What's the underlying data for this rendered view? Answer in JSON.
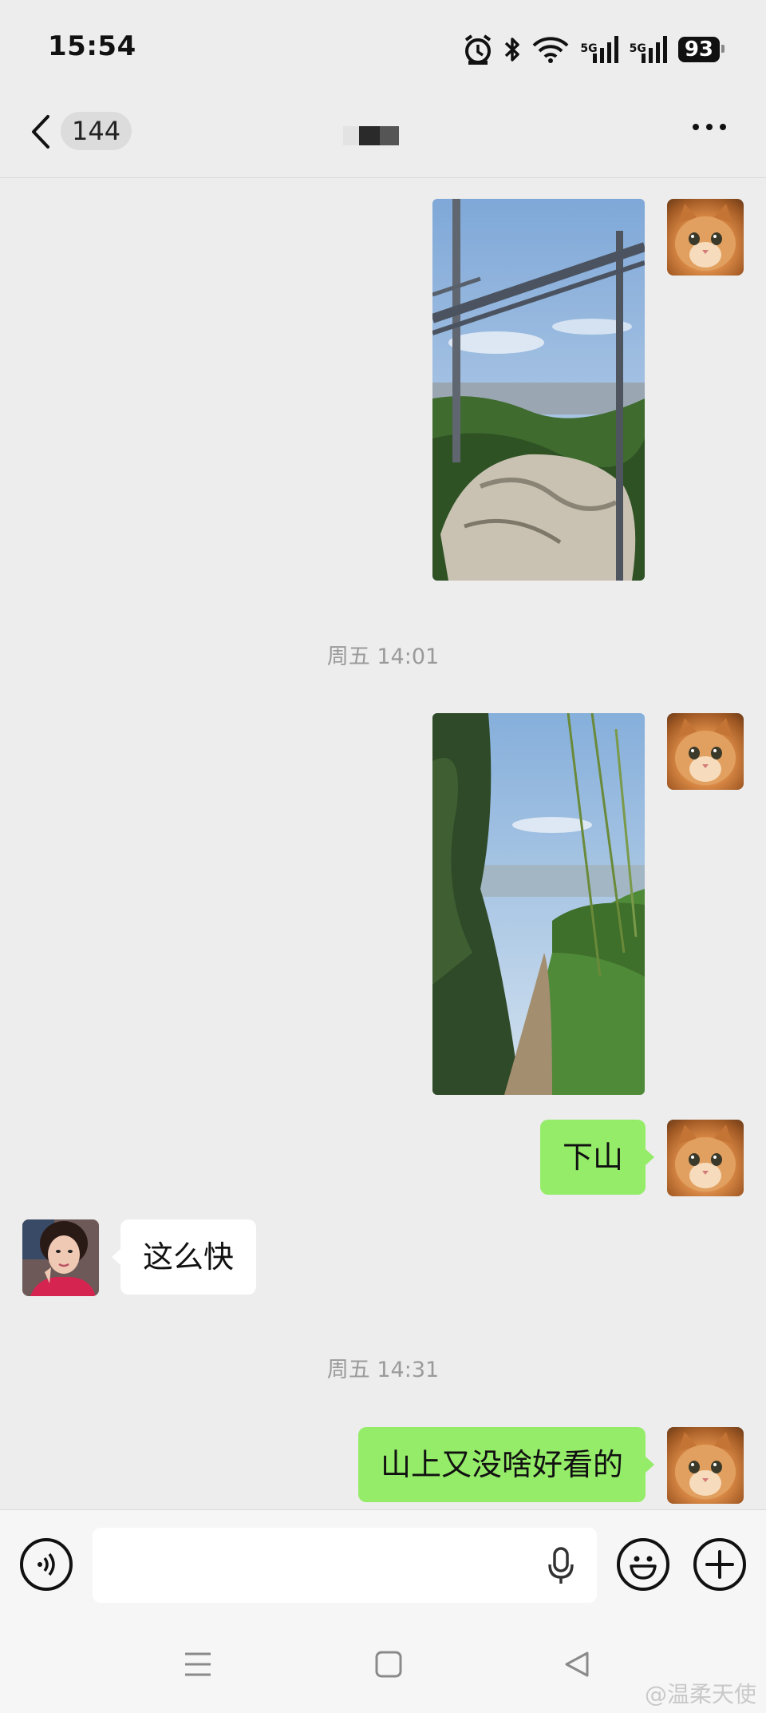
{
  "status_bar": {
    "time": "15:54",
    "network_1": "5G",
    "network_2": "5G",
    "battery": "93"
  },
  "header": {
    "unread_count": "144",
    "title_redacted": true
  },
  "messages": [
    {
      "type": "image",
      "from": "me",
      "subject": "mountain-top-rock-with-railway-frame"
    },
    {
      "type": "timestamp",
      "text": "周五 14:01"
    },
    {
      "type": "image",
      "from": "me",
      "subject": "mountain-trail-view"
    },
    {
      "type": "text",
      "from": "me",
      "text": "下山"
    },
    {
      "type": "text",
      "from": "other",
      "text": "这么快"
    },
    {
      "type": "timestamp",
      "text": "周五 14:31"
    },
    {
      "type": "text",
      "from": "me",
      "text": "山上又没啥好看的"
    }
  ],
  "input": {
    "value": "",
    "placeholder": ""
  },
  "icons": {
    "back": "chevron-left-icon",
    "more": "more-dots-icon",
    "voice": "voice-icon",
    "mic": "microphone-icon",
    "emoji": "emoji-icon",
    "plus": "plus-icon"
  },
  "watermark": "@温柔天使",
  "colors": {
    "background": "#ededed",
    "my_bubble": "#95ec69",
    "their_bubble": "#ffffff",
    "timestamp": "#9a9a9a"
  }
}
